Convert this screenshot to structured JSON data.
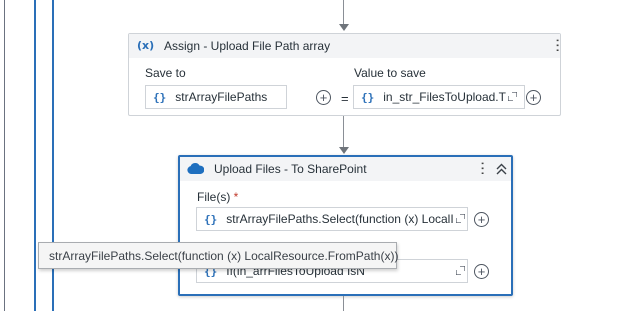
{
  "assign_activity": {
    "icon": "assign-icon",
    "icon_glyph": "(x)",
    "title": "Assign - Upload File Path array",
    "save_to_label": "Save to",
    "save_to_value": "strArrayFilePaths",
    "equals": "=",
    "value_to_save_label": "Value to save",
    "value_to_save_value": "in_str_FilesToUpload.T",
    "menu_icon": "more-vertical-icon"
  },
  "upload_activity": {
    "icon": "cloud-icon",
    "title": "Upload Files - To SharePoint",
    "files_label": "File(s)",
    "required_marker": "*",
    "files_value": "strArrayFilePaths.Select(function (x) LocalI",
    "second_value": "If(in_arrFilesToUpload IsN",
    "menu_icon": "more-vertical-icon",
    "collapse_icon": "collapse-chevron-icon"
  },
  "tooltip": {
    "text": "strArrayFilePaths.Select(function (x) LocalResource.FromPath(x))"
  },
  "field_brace": "{}",
  "colors": {
    "accent_blue": "#1f6fbf",
    "selected_border": "#2a6fb8",
    "header_bg": "#f3f4f6",
    "required_red": "#c0392b"
  }
}
